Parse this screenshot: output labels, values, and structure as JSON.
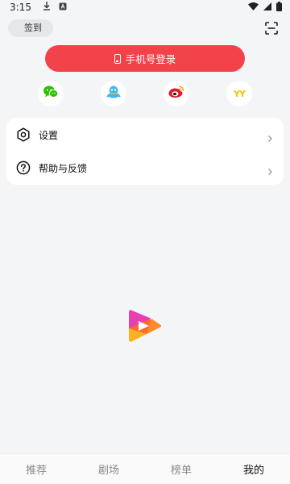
{
  "status_bar": {
    "time": "3:15"
  },
  "header": {
    "checkin_label": "签到"
  },
  "login": {
    "label": "手机号登录"
  },
  "social_logins": {
    "items": [
      {
        "name": "wechat",
        "icon": "wechat-icon",
        "color": "#2dc100"
      },
      {
        "name": "qq",
        "icon": "qq-icon",
        "color": "#3eb6f0"
      },
      {
        "name": "weibo",
        "icon": "weibo-icon",
        "color": "#e6162d"
      },
      {
        "name": "yy",
        "icon": "yy-icon",
        "label": "YY",
        "color": "#f5c400"
      }
    ]
  },
  "menu": {
    "items": [
      {
        "label": "设置",
        "icon": "settings-icon"
      },
      {
        "label": "帮助与反馈",
        "icon": "help-icon"
      }
    ]
  },
  "bottom_nav": {
    "tabs": [
      {
        "label": "推荐"
      },
      {
        "label": "剧场"
      },
      {
        "label": "榜单"
      },
      {
        "label": "我的",
        "active": true
      }
    ]
  },
  "colors": {
    "accent": "#f2434a",
    "background": "#f4f5f7"
  }
}
